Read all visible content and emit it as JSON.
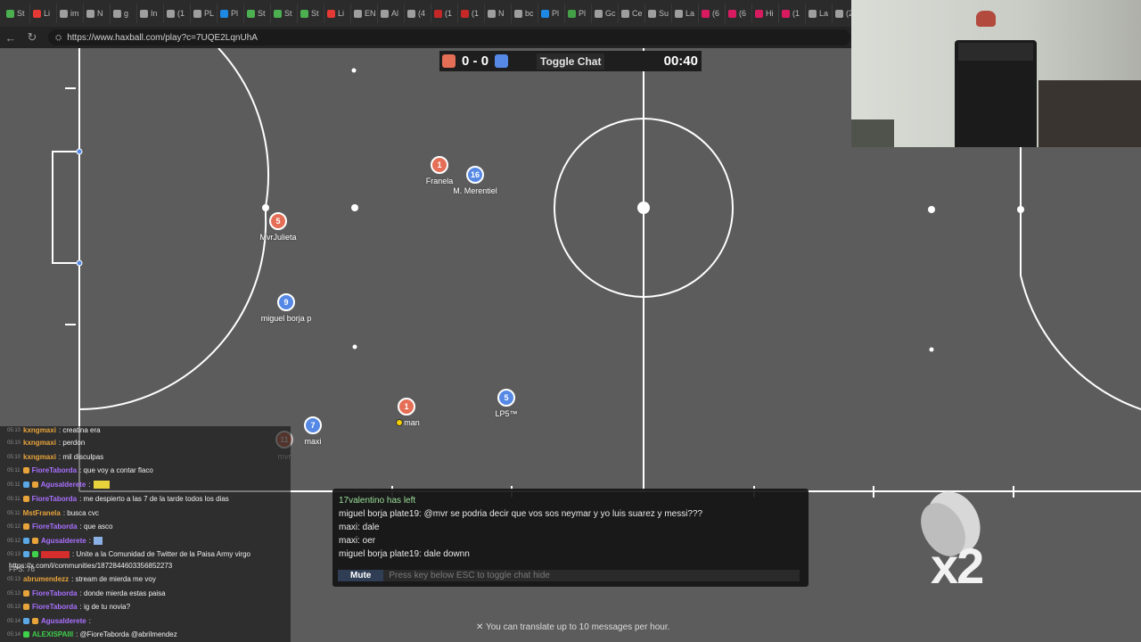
{
  "browser": {
    "tabs": [
      {
        "label": "St",
        "color": "#4caf50"
      },
      {
        "label": "Li",
        "color": "#e53935"
      },
      {
        "label": "im",
        "color": "#9e9e9e"
      },
      {
        "label": "N",
        "color": "#9e9e9e"
      },
      {
        "label": "g",
        "color": "#9e9e9e"
      },
      {
        "label": "In",
        "color": "#9e9e9e"
      },
      {
        "label": "(1",
        "color": "#9e9e9e"
      },
      {
        "label": "PL",
        "color": "#9e9e9e"
      },
      {
        "label": "Pl",
        "color": "#1e88e5"
      },
      {
        "label": "St",
        "color": "#4caf50"
      },
      {
        "label": "St",
        "color": "#4caf50"
      },
      {
        "label": "St",
        "color": "#4caf50"
      },
      {
        "label": "Li",
        "color": "#e53935"
      },
      {
        "label": "EN",
        "color": "#9e9e9e"
      },
      {
        "label": "Al",
        "color": "#9e9e9e"
      },
      {
        "label": "(4",
        "color": "#9e9e9e"
      },
      {
        "label": "(1",
        "color": "#c62828"
      },
      {
        "label": "(1",
        "color": "#c62828"
      },
      {
        "label": "N",
        "color": "#9e9e9e"
      },
      {
        "label": "bc",
        "color": "#9e9e9e"
      },
      {
        "label": "Pl",
        "color": "#1e88e5"
      },
      {
        "label": "Pl",
        "color": "#43a047"
      },
      {
        "label": "Gc",
        "color": "#9e9e9e"
      },
      {
        "label": "Ce",
        "color": "#9e9e9e"
      },
      {
        "label": "Su",
        "color": "#9e9e9e"
      },
      {
        "label": "La",
        "color": "#9e9e9e"
      },
      {
        "label": "(6",
        "color": "#d81b60"
      },
      {
        "label": "(6",
        "color": "#d81b60"
      },
      {
        "label": "Hi",
        "color": "#d81b60"
      },
      {
        "label": "(1",
        "color": "#d81b60"
      },
      {
        "label": "La",
        "color": "#9e9e9e"
      },
      {
        "label": "(2",
        "color": "#9e9e9e"
      }
    ],
    "url": "https://www.haxball.com/play?c=7UQE2LqnUhA"
  },
  "game": {
    "score_red": "0",
    "score_sep": "-",
    "score_blue": "0",
    "toggle_chat": "Toggle Chat",
    "timer": "00:40",
    "colors": {
      "red": "#e56e56",
      "blue": "#5689e5",
      "pitch": "#5c5c5c"
    },
    "players": [
      {
        "num": "1",
        "name": "Franela",
        "team": "red"
      },
      {
        "num": "16",
        "name": "M. Merentiel",
        "team": "blue"
      },
      {
        "num": "5",
        "name": "MvrJulieta",
        "team": "red"
      },
      {
        "num": "9",
        "name": "miguel borja p",
        "team": "blue"
      },
      {
        "num": "7",
        "name": "maxi",
        "team": "blue"
      },
      {
        "num": "11",
        "name": "mvr",
        "team": "red"
      },
      {
        "num": "1",
        "name": "man",
        "team": "red"
      },
      {
        "num": "5",
        "name": "LP5™",
        "team": "blue"
      }
    ]
  },
  "haxchat": {
    "messages": [
      {
        "text": "17valentino has left",
        "type": "notice"
      },
      {
        "text": "miguel borja plate19: @mvr se podria decir que vos sos neymar y yo luis suarez y messi???",
        "type": "msg"
      },
      {
        "text": "maxi: dale",
        "type": "msg"
      },
      {
        "text": "maxi: oer",
        "type": "msg"
      },
      {
        "text": "miguel borja plate19: dale downn",
        "type": "msg"
      }
    ],
    "mute_label": "Mute",
    "input_placeholder": "Press key below ESC to toggle chat hide",
    "translate_note": "✕ You can translate up to 10 messages per hour."
  },
  "stream_chat": {
    "lines": [
      {
        "time": "05:10",
        "user": "kxngmaxi",
        "color": "#e8a43b",
        "text": ": creatina era"
      },
      {
        "time": "05:10",
        "user": "kxngmaxi",
        "color": "#e8a43b",
        "text": ": perdon"
      },
      {
        "time": "05:10",
        "user": "kxngmaxi",
        "color": "#e8a43b",
        "text": ": mil disculpas"
      },
      {
        "time": "05:11",
        "user": "FioreTaborda",
        "color": "#a970ff",
        "text": ": que voy a contar flaco"
      },
      {
        "time": "05:11",
        "user": "Agusalderete",
        "color": "#a970ff",
        "text": ":"
      },
      {
        "time": "05:11",
        "user": "FioreTaborda",
        "color": "#a970ff",
        "text": ": me despierto a las 7 de la tarde todos los dias"
      },
      {
        "time": "05:11",
        "user": "MstFranela",
        "color": "#e8a43b",
        "text": ": busca cvc"
      },
      {
        "time": "05:12",
        "user": "FioreTaborda",
        "color": "#a970ff",
        "text": ": que asco"
      },
      {
        "time": "05:12",
        "user": "Agusalderete",
        "color": "#a970ff",
        "text": ":"
      },
      {
        "time": "05:13",
        "user": "",
        "color": "#d62d2d",
        "text": ": Unite a la Comunidad de Twitter de la Paisa Army virgo"
      },
      {
        "time": "",
        "user": "",
        "color": "#ffffff",
        "text": "https://x.com/i/communities/1872844603356852273"
      },
      {
        "time": "05:13",
        "user": "abrumendezz",
        "color": "#e8a43b",
        "text": ": stream de mierda me voy"
      },
      {
        "time": "05:13",
        "user": "FioreTaborda",
        "color": "#a970ff",
        "text": ": donde mierda estas paisa"
      },
      {
        "time": "05:13",
        "user": "FioreTaborda",
        "color": "#a970ff",
        "text": ": ig de tu novia?"
      },
      {
        "time": "05:14",
        "user": "Agusalderete",
        "color": "#a970ff",
        "text": ":"
      },
      {
        "time": "05:14",
        "user": "ALEXISPAIII",
        "color": "#3fd14b",
        "text": ": @FioreTaborda @abrilmendez"
      }
    ],
    "fps": "FPS: 76"
  },
  "overlay": {
    "multiplier": "x2"
  }
}
